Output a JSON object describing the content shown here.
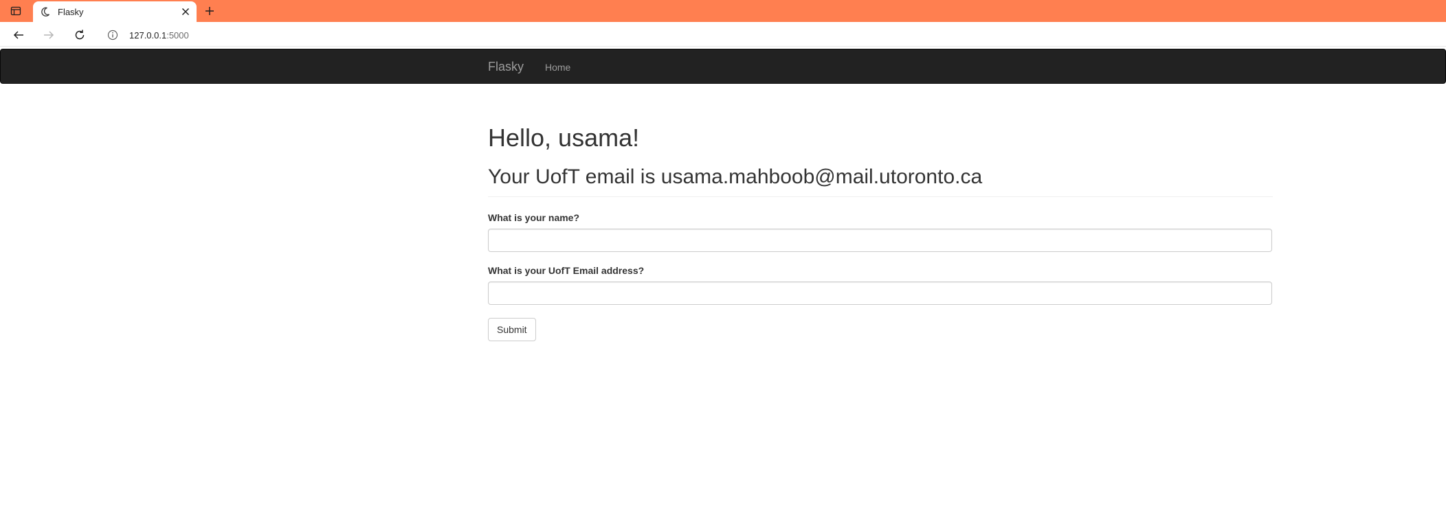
{
  "browser": {
    "tab": {
      "title": "Flasky",
      "favicon": "moon-favicon-icon"
    },
    "new_tab_icon": "plus-icon",
    "close_tab_icon": "close-icon",
    "address": {
      "host": "127.0.0.1",
      "port": ":5000",
      "info_icon": "info-icon"
    },
    "colors": {
      "tabstrip": "#ff7f50"
    }
  },
  "navbar": {
    "brand": "Flasky",
    "links": [
      "Home"
    ]
  },
  "main": {
    "greeting": "Hello, usama!",
    "email_line": "Your UofT email is usama.mahboob@mail.utoronto.ca",
    "form": {
      "name_label": "What is your name?",
      "name_value": "",
      "email_label": "What is your UofT Email address?",
      "email_value": "",
      "submit_label": "Submit"
    }
  }
}
